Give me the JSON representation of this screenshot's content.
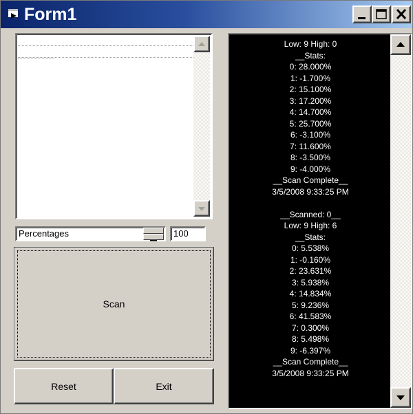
{
  "window": {
    "title": "Form1"
  },
  "caption_buttons": {
    "minimize": "minimize-icon",
    "maximize": "maximize-icon",
    "close": "close-icon"
  },
  "list": {
    "items": [
      "",
      ""
    ]
  },
  "combo": {
    "value": "Percentages"
  },
  "spin_value": "100",
  "buttons": {
    "scan": "Scan",
    "reset": "Reset",
    "exit": "Exit"
  },
  "output": {
    "lines": [
      "Low: 9 High: 0",
      "__Stats:",
      "0: 28.000%",
      "1: -1.700%",
      "2: 15.100%",
      "3: 17.200%",
      "4: 14.700%",
      "5: 25.700%",
      "6: -3.100%",
      "7: 11.600%",
      "8: -3.500%",
      "9: -4.000%",
      "__Scan Complete__",
      "3/5/2008 9:33:25 PM",
      "",
      "__Scanned: 0__",
      "Low: 9 High: 6",
      "__Stats:",
      "0: 5.538%",
      "1: -0.160%",
      "2: 23.631%",
      "3: 5.938%",
      "4: 14.834%",
      "5: 9.236%",
      "6: 41.583%",
      "7: 0.300%",
      "8: 5.498%",
      "9: -6.397%",
      "__Scan Complete__",
      "3/5/2008 9:33:25 PM"
    ]
  },
  "colors": {
    "titlebar": "#0a246a",
    "face": "#d4d0c8",
    "output_bg": "#000000",
    "output_text": "#ffffff"
  }
}
